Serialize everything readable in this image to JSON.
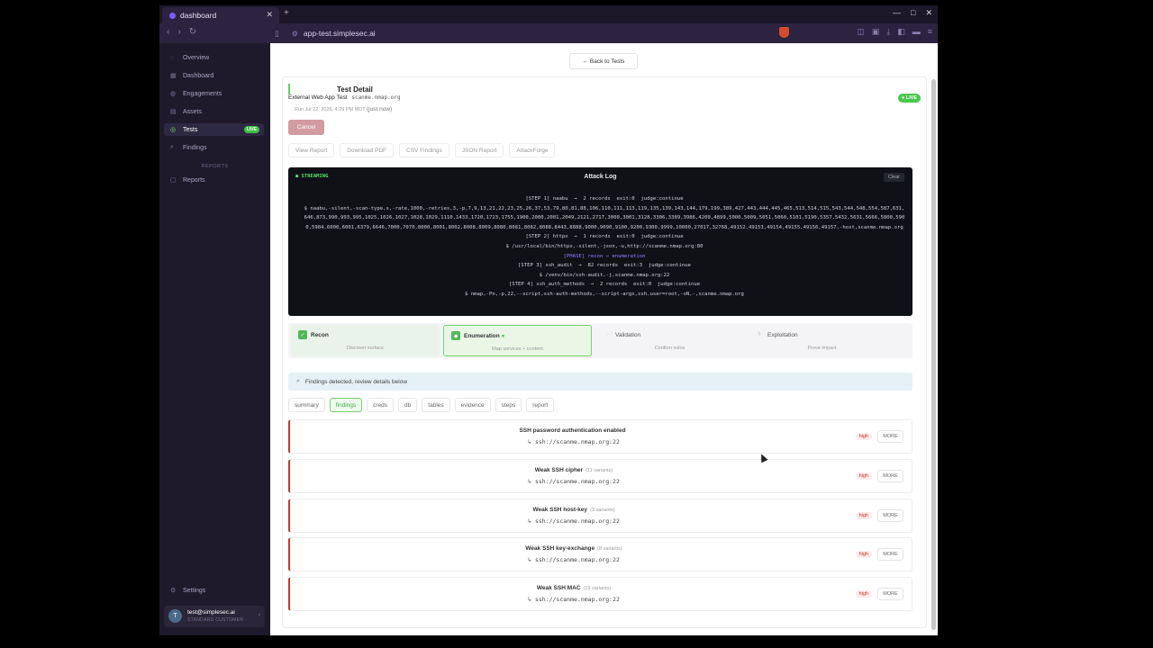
{
  "browser": {
    "tab_title": "dashboard",
    "url": "app-test.simplesec.ai"
  },
  "sidebar": {
    "items": [
      {
        "label": "Overview",
        "icon": "circle-icon"
      },
      {
        "label": "Dashboard",
        "icon": "grid-icon"
      },
      {
        "label": "Engagements",
        "icon": "briefcase-icon"
      },
      {
        "label": "Assets",
        "icon": "server-icon"
      },
      {
        "label": "Tests",
        "icon": "target-icon",
        "badge": "LIVE"
      },
      {
        "label": "Findings",
        "icon": "search-icon"
      }
    ],
    "section_reports": "REPORTS",
    "reports_label": "Reports",
    "settings_label": "Settings",
    "user": {
      "initial": "T",
      "email": "test@simplesec.ai",
      "role": "STANDARD CUSTOMER"
    }
  },
  "main": {
    "back_label": "← Back to Tests",
    "title": "Test Detail",
    "subtitle": "External Web App Test",
    "host": "scanme.nmap.org",
    "run_info": "Run Jul 22, 2026, 4:29 PM MDT",
    "run_ago": "(just now)",
    "live_pill": "● LIVE",
    "cancel_label": "Cancel",
    "actions": [
      "View Report",
      "Download PDF",
      "CSV Findings",
      "JSON Report",
      "AttackForge"
    ],
    "log": {
      "stream_label": "● STREAMING",
      "title": "Attack Log",
      "clear_label": "Clear",
      "lines": [
        {
          "text": "[STEP 1] naabu  →  2 records  exit:0  judge:continue",
          "phase": false
        },
        {
          "text": "$ naabu,-silent,-scan-type,s,-rate,1000,-retries,3,-p,7,9,13,21,22,23,25,26,37,53,79,80,81,88,106,110,111,113,119,135,139,143,144,179,199,389,427,443,444,445,465,513,514,515,543,544,548,554,587,631,646,873,990,993,995,1025,1026,1027,1028,1029,1110,1433,1720,1723,1755,1900,2000,2001,2049,2121,2717,3000,3001,3128,3306,3389,3986,4200,4899,5000,5009,5051,5060,5101,5190,5357,5432,5631,5666,5800,5900,5984,6000,6001,6379,6646,7000,7070,8000,8001,8002,8008,8009,8080,8081,8082,8088,8443,8888,9000,9090,9100,9200,9300,9999,10000,27017,32768,49152,49153,49154,49155,49156,49157,-host,scanme.nmap.org",
          "phase": false
        },
        {
          "text": "[STEP 2] httpx  →  1 records  exit:0  judge:continue",
          "phase": false
        },
        {
          "text": "$ /usr/local/bin/httpx,-silent,-json,-u,http://scanme.nmap.org:80",
          "phase": false
        },
        {
          "text": "[PHASE] recon → enumeration",
          "phase": true
        },
        {
          "text": "[STEP 3] ssh_audit  →  82 records  exit:3  judge:continue",
          "phase": false
        },
        {
          "text": "$ /venv/bin/ssh-audit,-j,scanme.nmap.org:22",
          "phase": false
        },
        {
          "text": "[STEP 4] ssh_auth_methods  →  2 records  exit:0  judge:continue",
          "phase": false
        },
        {
          "text": "$ nmap,-Pn,-p,22,--script,ssh-auth-methods,--script-args,ssh.user=root,-oN,-,scanme.nmap.org",
          "phase": false
        }
      ]
    },
    "phases": [
      {
        "name": "Recon",
        "desc": "Discover surface",
        "state": "done"
      },
      {
        "name": "Enumeration",
        "desc": "Map services + content",
        "state": "active"
      },
      {
        "name": "Validation",
        "desc": "Confirm vulns",
        "state": "todo"
      },
      {
        "name": "Exploitation",
        "desc": "Prove impact",
        "state": "todo"
      }
    ],
    "banner": "Findings detected, review details below",
    "tabs": [
      "summary",
      "findings",
      "creds",
      "db",
      "tables",
      "evidence",
      "steps",
      "report"
    ],
    "active_tab": "findings",
    "findings": [
      {
        "name": "SSH password authentication enabled",
        "variants": "",
        "target": "↳ ssh://scanme.nmap.org:22",
        "severity": "high",
        "more": "MORE"
      },
      {
        "name": "Weak SSH cipher",
        "variants": "(11 variants)",
        "target": "↳ ssh://scanme.nmap.org:22",
        "severity": "high",
        "more": "MORE"
      },
      {
        "name": "Weak SSH host-key",
        "variants": "(3 variants)",
        "target": "↳ ssh://scanme.nmap.org:22",
        "severity": "high",
        "more": "MORE"
      },
      {
        "name": "Weak SSH key-exchange",
        "variants": "(8 variants)",
        "target": "↳ ssh://scanme.nmap.org:22",
        "severity": "high",
        "more": "MORE"
      },
      {
        "name": "Weak SSH MAC",
        "variants": "(19 variants)",
        "target": "↳ ssh://scanme.nmap.org:22",
        "severity": "high",
        "more": "MORE"
      }
    ]
  },
  "colors": {
    "accent": "#49c84f",
    "severity_high": "#c0392b",
    "sidebar_bg": "#1e1a2c",
    "log_bg": "#0f1117"
  }
}
